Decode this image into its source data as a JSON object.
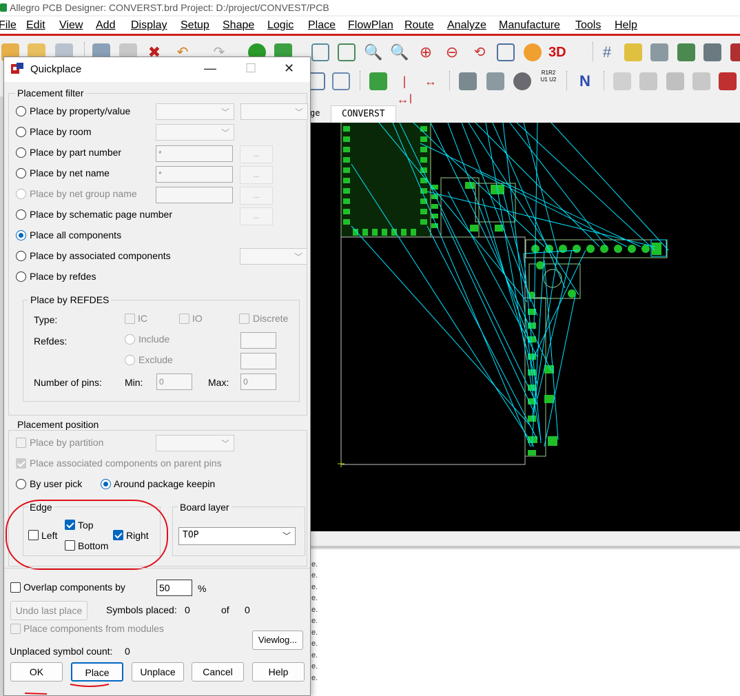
{
  "app": {
    "title": "Allegro PCB Designer: CONVERST.brd  Project: D:/project/CONVEST/PCB"
  },
  "menu": [
    "File",
    "Edit",
    "View",
    "Add",
    "Display",
    "Setup",
    "Shape",
    "Logic",
    "Place",
    "FlowPlan",
    "Route",
    "Analyze",
    "Manufacture",
    "Tools",
    "Help"
  ],
  "toolbar": {
    "threed_label": "3D",
    "resistor_label": "R1R2 U1 U2"
  },
  "tabs": {
    "partial": "ge",
    "active": "CONVERST"
  },
  "console": {
    "line_char": "e."
  },
  "colors": {
    "canvas": "#000000",
    "ratsnest": "#00e5ff",
    "pad": "#1fbf2a",
    "outline": "#9acb8a",
    "accent": "#0067c0",
    "annotation": "#e0101a"
  },
  "dialog": {
    "title": "Quickplace",
    "filter": {
      "label": "Placement filter",
      "options": [
        {
          "label": "Place by property/value",
          "enabled": true,
          "selected": false
        },
        {
          "label": "Place by room",
          "enabled": true,
          "selected": false
        },
        {
          "label": "Place by part number",
          "enabled": true,
          "selected": false
        },
        {
          "label": "Place by net name",
          "enabled": true,
          "selected": false
        },
        {
          "label": "Place by net group name",
          "enabled": false,
          "selected": false
        },
        {
          "label": "Place by schematic page number",
          "enabled": true,
          "selected": false
        },
        {
          "label": "Place all components",
          "enabled": true,
          "selected": true
        },
        {
          "label": "Place by associated components",
          "enabled": true,
          "selected": false
        },
        {
          "label": "Place by refdes",
          "enabled": true,
          "selected": false
        }
      ],
      "part_number_value": "*",
      "net_name_value": "*",
      "browse_label": "..."
    },
    "refdes": {
      "label": "Place by REFDES",
      "type_label": "Type:",
      "type_ic": "IC",
      "type_io": "IO",
      "type_discrete": "Discrete",
      "refdes_label": "Refdes:",
      "include": "Include",
      "exclude": "Exclude",
      "pins_label": "Number of pins:",
      "min_label": "Min:",
      "min_value": "0",
      "max_label": "Max:",
      "max_value": "0"
    },
    "position": {
      "label": "Placement position",
      "by_partition": "Place by partition",
      "assoc_parent": "Place associated components on parent pins",
      "by_user_pick": "By user pick",
      "around_keepin": "Around package keepin",
      "edge": {
        "label": "Edge",
        "left": "Left",
        "top": "Top",
        "bottom": "Bottom",
        "right": "Right",
        "left_checked": false,
        "top_checked": true,
        "bottom_checked": false,
        "right_checked": true
      },
      "board_layer": {
        "label": "Board layer",
        "value": "TOP"
      }
    },
    "overlap": {
      "label": "Overlap components by",
      "value": "50",
      "unit": "%"
    },
    "undo_label": "Undo last place",
    "symbols_placed_label": "Symbols placed:",
    "symbols_placed": "0",
    "of_label": "of",
    "symbols_total": "0",
    "from_modules": "Place components from modules",
    "viewlog": "Viewlog...",
    "unplaced_label": "Unplaced symbol count:",
    "unplaced_count": "0",
    "buttons": {
      "ok": "OK",
      "place": "Place",
      "unplace": "Unplace",
      "cancel": "Cancel",
      "help": "Help"
    }
  }
}
